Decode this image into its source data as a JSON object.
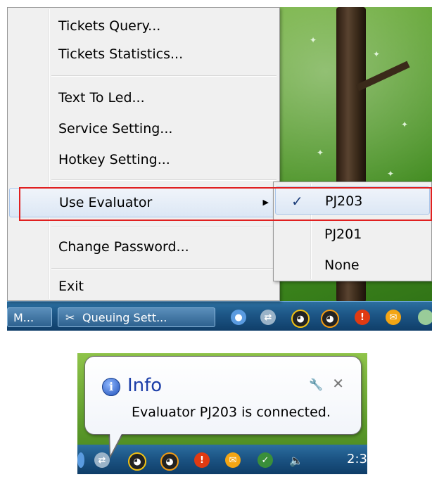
{
  "context_menu": {
    "items": [
      {
        "label": "Tickets Query...",
        "name": "tickets-query"
      },
      {
        "label": "Tickets Statistics...",
        "name": "tickets-statistics"
      },
      {
        "label": "Text To Led...",
        "name": "text-to-led"
      },
      {
        "label": "Service Setting...",
        "name": "service-setting"
      },
      {
        "label": "Hotkey Setting...",
        "name": "hotkey-setting"
      },
      {
        "label": "Use Evaluator",
        "name": "use-evaluator",
        "submenu_arrow": "▶"
      },
      {
        "label": "Change Password...",
        "name": "change-password"
      },
      {
        "label": "Exit",
        "name": "exit"
      }
    ]
  },
  "evaluator_submenu": {
    "items": [
      {
        "label": "PJ203",
        "checked": true
      },
      {
        "label": "PJ201",
        "checked": false
      },
      {
        "label": "None",
        "checked": false
      }
    ],
    "check_glyph": "✓"
  },
  "taskbar": {
    "buttons": [
      {
        "label": "M..."
      },
      {
        "label": "Queuing Sett..."
      }
    ],
    "tray_icons": [
      "network-icon",
      "qq-penguin-icon",
      "qq-penguin-message-icon",
      "alert-icon",
      "mail-icon"
    ]
  },
  "notification": {
    "title": "Info",
    "message": "Evaluator PJ203 is connected.",
    "icon": "info-icon",
    "close_glyph": "✕",
    "pin_glyph": "🔧",
    "clock": "2:3"
  },
  "colors": {
    "highlight_border": "#e02020",
    "menu_bg": "#f0f0f0",
    "balloon_title": "#1c3ea8"
  }
}
